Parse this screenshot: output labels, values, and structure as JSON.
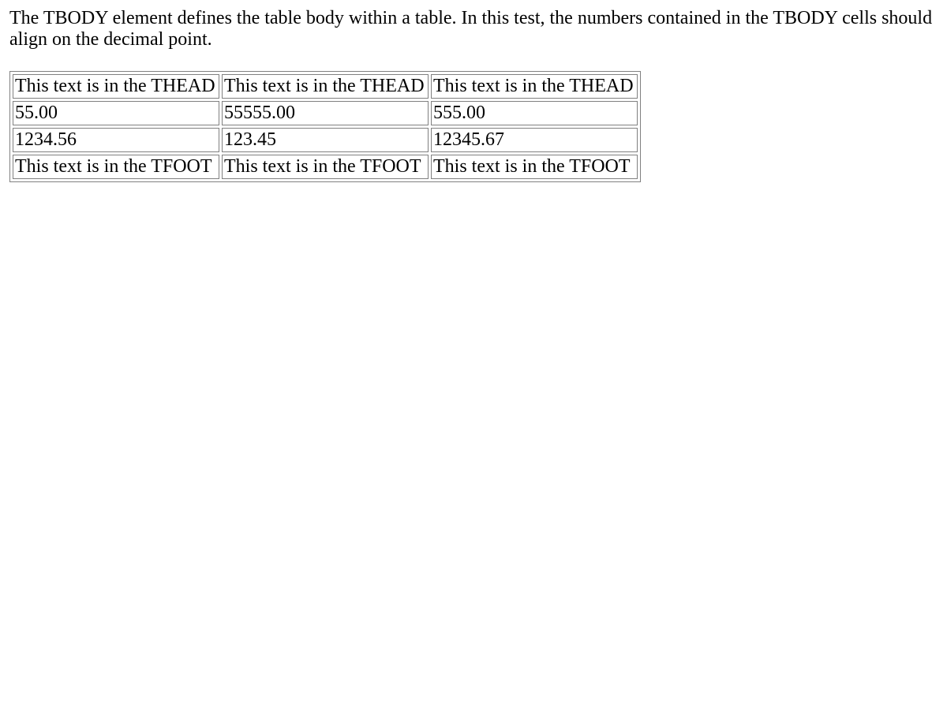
{
  "description": "The TBODY element defines the table body within a table. In this test, the numbers contained in the TBODY cells should align on the decimal point.",
  "table": {
    "thead": [
      "This text is in the THEAD",
      "This text is in the THEAD",
      "This text is in the THEAD"
    ],
    "tbody": [
      [
        "55.00",
        "55555.00",
        "555.00"
      ],
      [
        "1234.56",
        "123.45",
        "12345.67"
      ]
    ],
    "tfoot": [
      "This text is in the TFOOT",
      "This text is in the TFOOT",
      "This text is in the TFOOT"
    ]
  }
}
